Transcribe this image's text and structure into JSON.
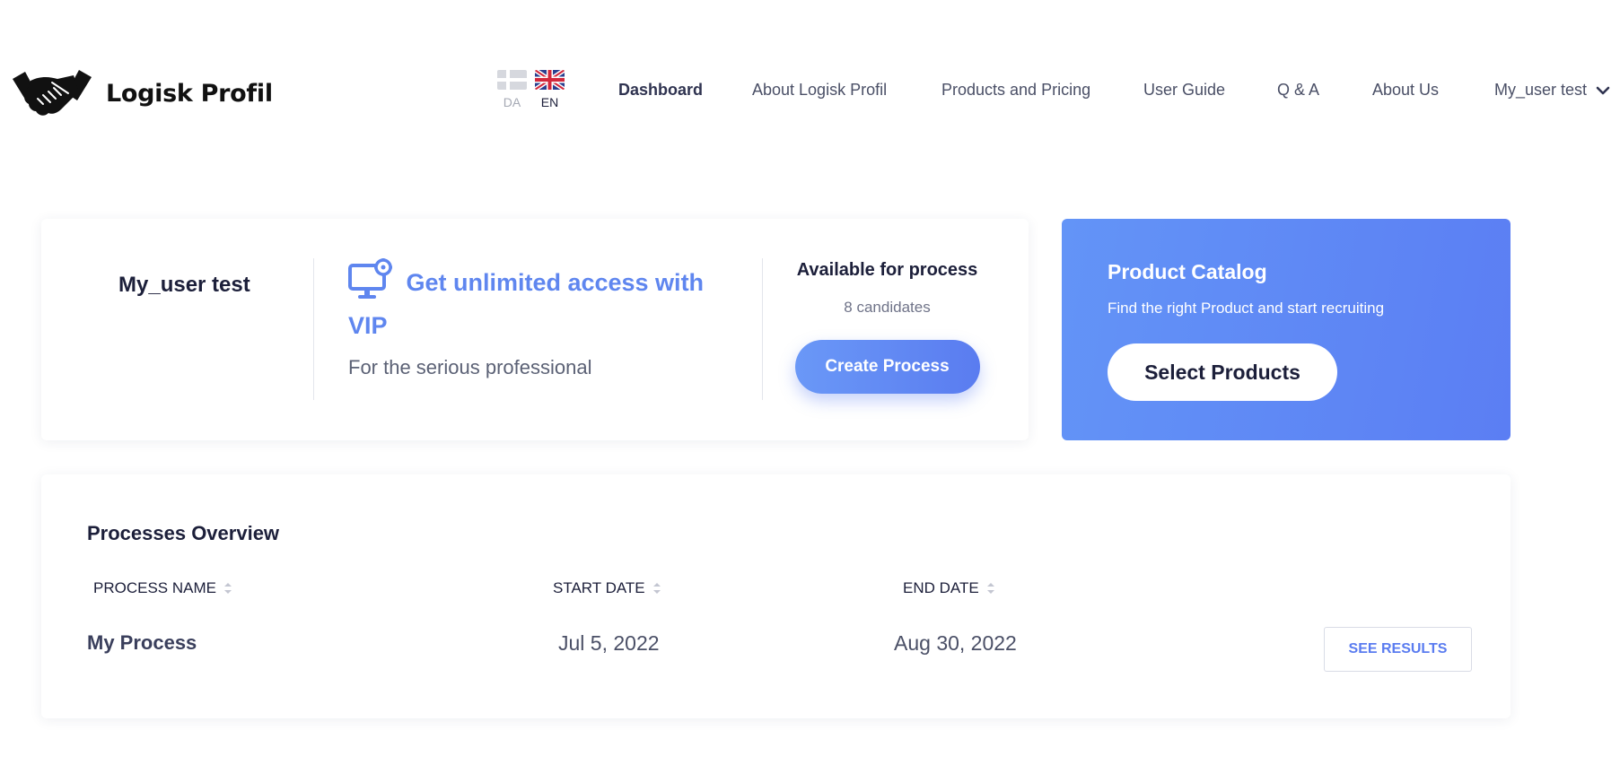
{
  "brand": {
    "name": "Logisk Profil",
    "icon": "handshake-icon"
  },
  "languages": [
    {
      "code": "DA",
      "icon": "danish-flag-icon",
      "active": false
    },
    {
      "code": "EN",
      "icon": "uk-flag-icon",
      "active": true
    }
  ],
  "nav": {
    "items": [
      {
        "label": "Dashboard",
        "active": true
      },
      {
        "label": "About Logisk Profil"
      },
      {
        "label": "Products and Pricing"
      },
      {
        "label": "User Guide"
      },
      {
        "label": "Q & A"
      },
      {
        "label": "About Us"
      }
    ],
    "user_menu": {
      "label": "My_user test",
      "icon": "chevron-down-icon"
    }
  },
  "user_card": {
    "user_name": "My_user test",
    "vip": {
      "icon": "monitor-gear-icon",
      "title": "Get unlimited access with VIP",
      "subtitle": "For the serious professional"
    },
    "availability": {
      "title": "Available for process",
      "count": "8 candidates",
      "button_label": "Create Process"
    }
  },
  "catalog_card": {
    "title": "Product Catalog",
    "subtitle": "Find the right Product and start recruiting",
    "button_label": "Select Products"
  },
  "processes": {
    "title": "Processes Overview",
    "columns": [
      "PROCESS NAME",
      "START DATE",
      "END DATE"
    ],
    "rows": [
      {
        "name": "My Process",
        "start": "Jul 5, 2022",
        "end": "Aug 30, 2022",
        "action": "SEE RESULTS"
      }
    ]
  },
  "colors": {
    "accent": "#5a7cf0",
    "accent_light": "#6394f7",
    "text_dark": "#1c1f3a",
    "text_muted": "#5b6175"
  }
}
